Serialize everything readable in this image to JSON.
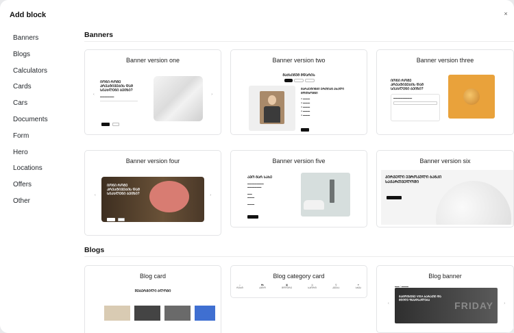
{
  "modal": {
    "title": "Add block",
    "close": "×"
  },
  "sidebar": {
    "items": [
      {
        "label": "Banners"
      },
      {
        "label": "Blogs"
      },
      {
        "label": "Calculators"
      },
      {
        "label": "Cards"
      },
      {
        "label": "Cars"
      },
      {
        "label": "Documents"
      },
      {
        "label": "Form"
      },
      {
        "label": "Hero"
      },
      {
        "label": "Locations"
      },
      {
        "label": "Offers"
      },
      {
        "label": "Other"
      }
    ]
  },
  "sections": {
    "banners": {
      "title": "Banners",
      "cards": [
        {
          "title": "Banner version one"
        },
        {
          "title": "Banner version two"
        },
        {
          "title": "Banner version three"
        },
        {
          "title": "Banner version four"
        },
        {
          "title": "Banner version five"
        },
        {
          "title": "Banner version six"
        }
      ]
    },
    "blogs": {
      "title": "Blogs",
      "cards": [
        {
          "title": "Blog card"
        },
        {
          "title": "Blog category card"
        },
        {
          "title": "Blog banner"
        }
      ]
    }
  },
  "previews": {
    "v1_heading": "ᲘᲝᲜᲘ ᲠᲝᲛᲔ ᲙᲠᲔᲐᲢᲘᲕᲔᲑᲘᲡ ᲓᲐᲛ ᲡᲘᲐᲮᲚᲔᲜᲘ ᲑᲔᲘᲖᲘ?",
    "v2_heading": "ᲛᲐᲥᲡᲘᲛᲣᲛ ᲛᲓᲐᲠᲘᲡ",
    "v2_sub": "ᲛᲐᲠᲙᲔᲢᲘᲜᲒᲘ ᲔᲠᲗᲘᲐᲜ ᲐᲮᲐᲚᲘ ᲛᲝᲗᲮᲝᲕᲜᲘ",
    "v3_heading": "ᲘᲝᲜᲘ ᲠᲝᲛᲔ ᲙᲠᲔᲐᲢᲘᲕᲔᲑᲘᲡ ᲓᲐᲛ ᲡᲘᲐᲮᲚᲔᲜᲘ ᲑᲔᲘᲖᲘ?",
    "v4_heading": "ᲘᲝᲜᲘ ᲠᲝᲛᲔ ᲙᲠᲔᲐᲢᲘᲕᲔᲑᲘᲡ ᲓᲐᲛ ᲡᲘᲐᲮᲚᲔᲜᲘ ᲑᲔᲘᲖᲘ?",
    "v5_heading": "ᲐᲕᲝ ᲛᲐᲠ ᲡᲐᲮᲔ",
    "v6_heading": "ᲞᲘᲠᲕᲔᲚᲘ ᲔᲕᲠᲝᲞᲣᲚᲘ ᲑᲐᲜᲙᲘ ᲡᲐᲥᲐᲠᲗᲕᲔᲚᲝᲨᲘ",
    "blog_heading": "ᲨᲔᲑᲔᲠᲒᲘᲚᲘ ᲑᲚᲝᲒᲘ",
    "blogbanner_heading": "ᲒᲐᲛᲝᲘᲧᲔᲜᲔ VISA ᲑᲐᲠᲐᲗᲘ ᲓᲐ ᲛᲘᲘᲦᲔ ᲤᲐᲡᲓᲐᲙᲚᲔᲑᲐ",
    "blogbanner_overlay": "FRIDAY",
    "categories": [
      "ᲠᲔᲡᲢ",
      "ᲐᲕᲢᲝ",
      "ᲛᲝᲦᲣᲠᲔ",
      "ᲡᲞᲝᲠᲢ",
      "ᲙᲕᲔᲑᲐ",
      "ᲡᲮᲕᲐ"
    ]
  },
  "colors": {
    "accent": "#1a1a1a",
    "orange": "#e9a23b",
    "pig_bg": "#5b4631",
    "pig": "#d87c72",
    "blog_banner_bg": "#3a3a3a"
  }
}
